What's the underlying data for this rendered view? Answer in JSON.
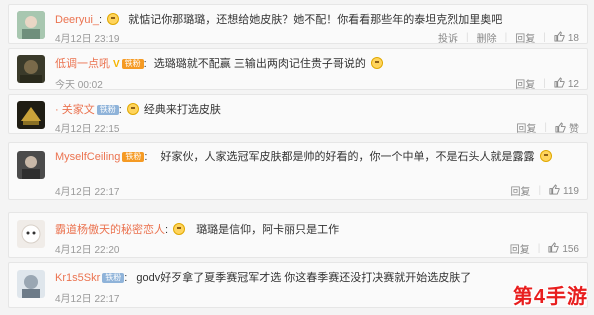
{
  "comments": [
    {
      "user": "Deeryui_",
      "text": "就惦记你那璐璐，还想给她皮肤？她不配！你看看那些年的泰坦克烈加里奥吧",
      "time": "4月12日 23:19",
      "actions": [
        "投诉",
        "删除",
        "回复"
      ],
      "likes": "18"
    },
    {
      "user": "低调一点吼",
      "badge": "铁粉",
      "text": "选璐璐就不配赢 三输出两肉记住贵子哥说的",
      "time": "今天 00:02",
      "actions": [
        "回复"
      ],
      "likes": "12"
    },
    {
      "user": "· 关家文",
      "badge": "铁粉",
      "text": "经典来打选皮肤",
      "time": "4月12日 22:15",
      "actions": [
        "回复"
      ],
      "likes": "赞"
    },
    {
      "user": "MyselfCeiling",
      "badge": "铁粉",
      "text": "好家伙，人家选冠军皮肤都是帅的好看的，你一个中单，不是石头人就是露露",
      "time": "4月12日 22:17",
      "actions": [
        "回复"
      ],
      "likes": "119"
    },
    {
      "user": "霸道杨傲天的秘密恋人",
      "text": "璐璐是信仰，阿卡丽只是工作",
      "time": "4月12日 22:20",
      "actions": [
        "回复"
      ],
      "likes": "156"
    },
    {
      "user": "Kr1s5Skr",
      "badge": "铁粉",
      "text": "godv好歹拿了夏季赛冠军才选 你这春季赛还没打决赛就开始选皮肤了",
      "time": "4月12日 22:17",
      "actions": [
        "回复"
      ],
      "likes": ""
    }
  ],
  "watermark": "第4手游",
  "colors": {
    "username": "#eb7350",
    "fan_badge": "#f59a23",
    "watermark": "#e81e1e"
  },
  "icons": {
    "like": "thumbs-up-icon",
    "emoji": "smiley-emoji-icon",
    "vip": "vip-v-icon"
  }
}
